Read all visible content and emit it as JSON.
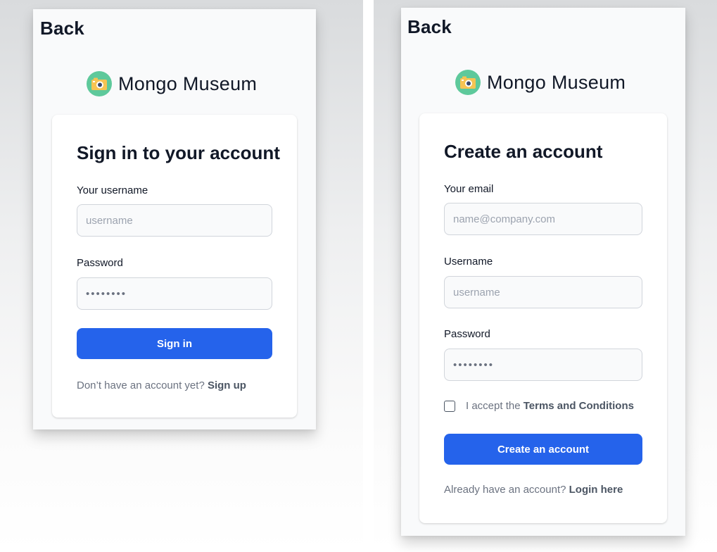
{
  "sign_in_screen": {
    "back_label": "Back",
    "brand": {
      "name": "Mongo Museum",
      "logo_icon": "camera-icon",
      "logo_bg": "#5ec99b"
    },
    "title": "Sign in to your account",
    "username": {
      "label": "Your username",
      "value": "",
      "placeholder": "username"
    },
    "password": {
      "label": "Password",
      "value": "",
      "placeholder": "••••••••"
    },
    "submit_label": "Sign in",
    "footer": {
      "text": "Don’t have an account yet?",
      "link": "Sign up"
    }
  },
  "sign_up_screen": {
    "back_label": "Back",
    "brand": {
      "name": "Mongo Museum",
      "logo_icon": "camera-icon",
      "logo_bg": "#5ec99b"
    },
    "title": "Create an account",
    "email": {
      "label": "Your email",
      "value": "",
      "placeholder": "name@company.com"
    },
    "username": {
      "label": "Username",
      "value": "",
      "placeholder": "username"
    },
    "password": {
      "label": "Password",
      "value": "",
      "placeholder": "••••••••"
    },
    "terms": {
      "checked": false,
      "text": "I accept the",
      "link": "Terms and Conditions"
    },
    "submit_label": "Create an account",
    "footer": {
      "text": "Already have an account?",
      "link": "Login here"
    }
  },
  "colors": {
    "primary_button": "#2563eb",
    "logo_circle": "#5ec99b",
    "text": "#111827",
    "muted": "#6b7280"
  }
}
